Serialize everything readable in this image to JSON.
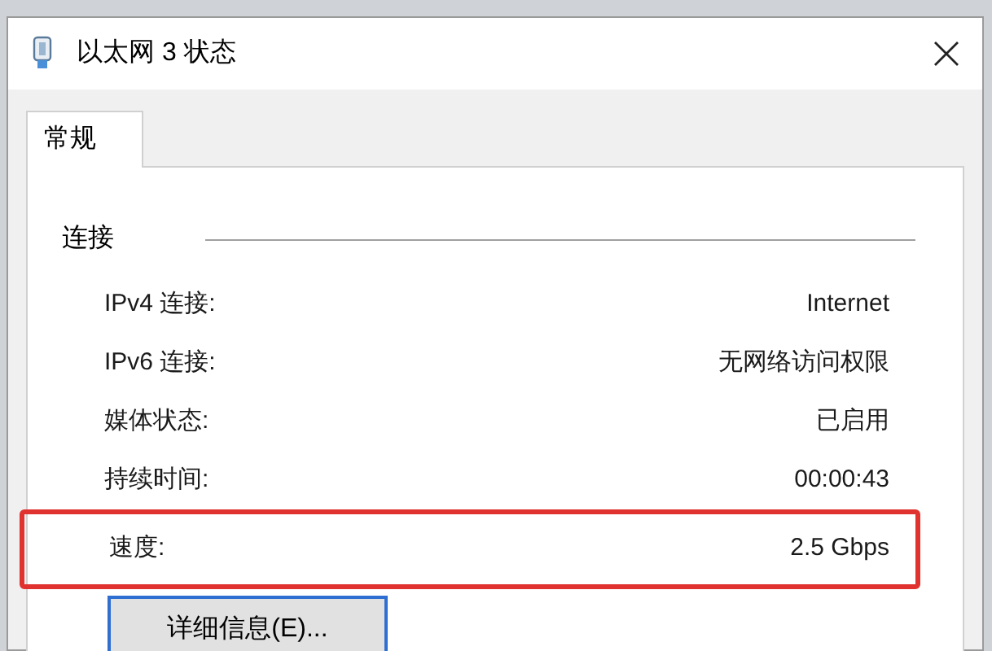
{
  "window": {
    "title": "以太网 3 状态"
  },
  "tabs": [
    {
      "label": "常规",
      "selected": true
    }
  ],
  "section": {
    "title": "连接"
  },
  "rows": [
    {
      "label": "IPv4 连接:",
      "value": "Internet",
      "highlighted": false
    },
    {
      "label": "IPv6 连接:",
      "value": "无网络访问权限",
      "highlighted": false
    },
    {
      "label": "媒体状态:",
      "value": "已启用",
      "highlighted": false
    },
    {
      "label": "持续时间:",
      "value": "00:00:43",
      "highlighted": false
    },
    {
      "label": "速度:",
      "value": "2.5 Gbps",
      "highlighted": true
    }
  ],
  "buttons": [
    {
      "label": "详细信息(E)...",
      "selected": true
    }
  ]
}
